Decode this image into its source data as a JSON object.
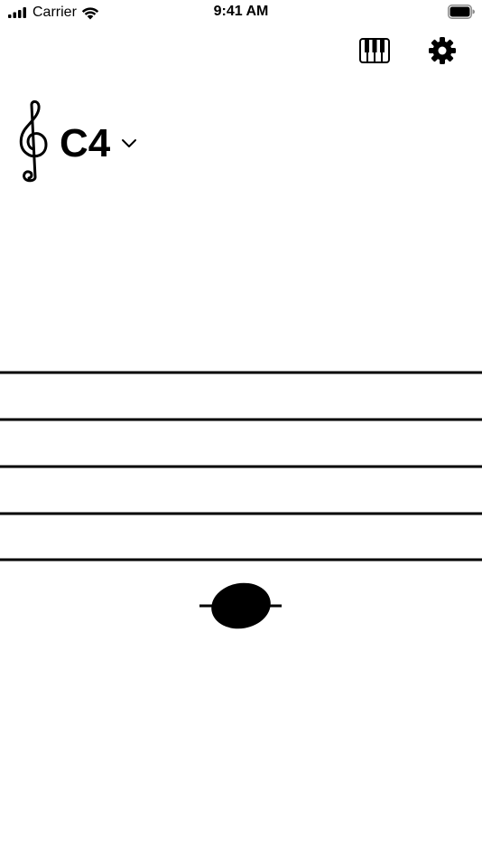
{
  "status_bar": {
    "carrier": "Carrier",
    "time": "9:41 AM"
  },
  "toolbar": {
    "piano_icon": "piano-keyboard-icon",
    "settings_icon": "gear-icon"
  },
  "note_selector": {
    "clef_icon": "treble-clef-icon",
    "note": "C4"
  },
  "staff": {
    "note": "C4"
  }
}
